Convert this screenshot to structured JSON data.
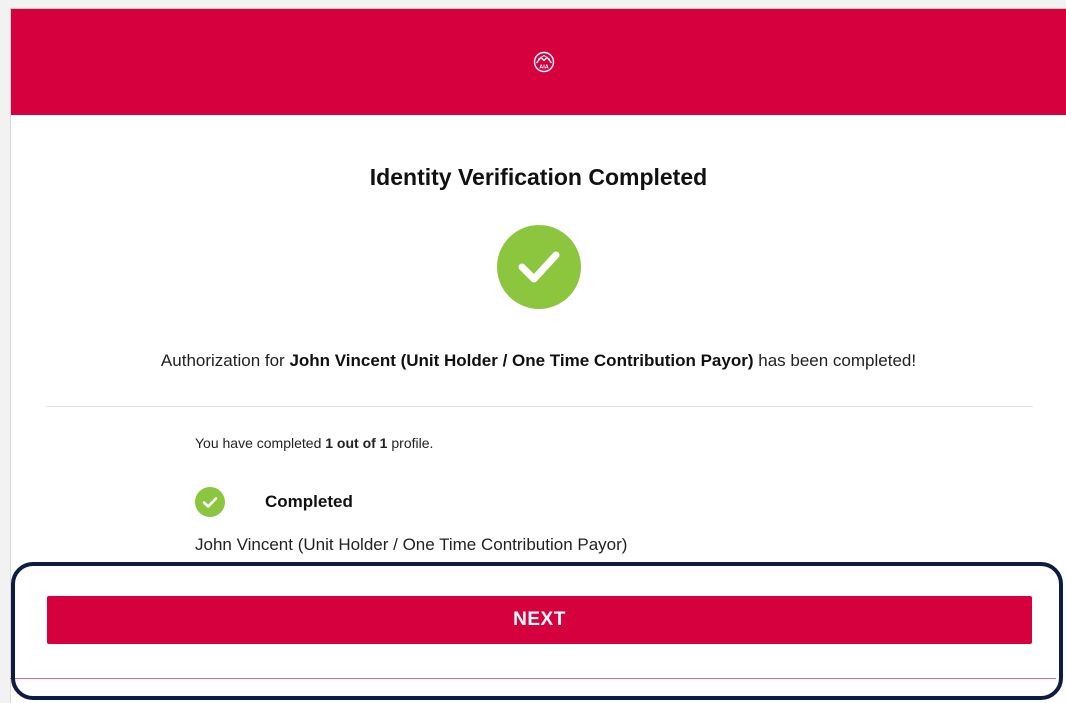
{
  "header": {
    "logo_icon": "aia-logo-icon",
    "logo_text": "AIA",
    "background_color": "#d6003f"
  },
  "main": {
    "title": "Identity Verification Completed",
    "status_icon": "check-circle-icon",
    "success_color": "#8cc63f",
    "authorization": {
      "prefix": "Authorization for ",
      "name": "John Vincent (Unit Holder / One Time Contribution Payor)",
      "suffix": " has been completed!"
    },
    "progress": {
      "prefix": "You have completed ",
      "count": "1 out of 1",
      "suffix": " profile."
    },
    "profiles": [
      {
        "status_icon": "check-circle-icon",
        "status_label": "Completed",
        "name": "John Vincent (Unit Holder / One Time Contribution Payor)"
      }
    ]
  },
  "footer": {
    "next_label": "NEXT",
    "button_color": "#d6003f",
    "highlight_color": "#0d1b45"
  }
}
